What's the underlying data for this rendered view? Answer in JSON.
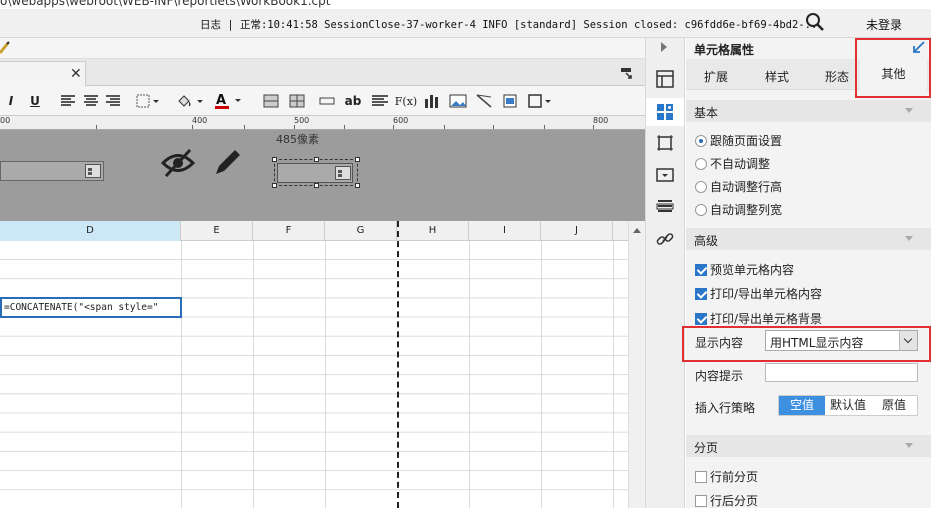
{
  "window": {
    "title_path": "o\\webapps\\webroot\\WEB-INF\\reportlets\\WorkBook1.cpt"
  },
  "statusbar": {
    "log_label": "日志",
    "log_text": "正常:10:41:58 SessionClose-37-worker-4 INFO [standard] Session closed: c96fdd6e-bf69-4bd2-...",
    "login_label": "未登录"
  },
  "design": {
    "width_label": "485像素"
  },
  "ruler": {
    "ticks": [
      "00",
      "400",
      "500",
      "600",
      "800"
    ]
  },
  "sheet": {
    "columns": [
      "D",
      "E",
      "F",
      "G",
      "H",
      "I",
      "J"
    ],
    "active_cell_text": "=CONCATENATE(\"<span style=\""
  },
  "toolbar": {
    "bold_label": "ab",
    "formula_label": "F(x)"
  },
  "panel": {
    "title": "单元格属性",
    "tabs": [
      "扩展",
      "样式",
      "形态",
      "其他"
    ],
    "active_tab": "其他",
    "basic": {
      "label": "基本",
      "options": [
        "跟随页面设置",
        "不自动调整",
        "自动调整行高",
        "自动调整列宽"
      ],
      "selected": "跟随页面设置"
    },
    "advanced": {
      "label": "高级",
      "checks": [
        "预览单元格内容",
        "打印/导出单元格内容",
        "打印/导出单元格背景"
      ],
      "display_label": "显示内容",
      "display_value": "用HTML显示内容",
      "hint_label": "内容提示",
      "hint_value": "",
      "insert_label": "插入行策略",
      "insert_options": [
        "空值",
        "默认值",
        "原值"
      ],
      "insert_selected": "空值"
    },
    "paging": {
      "label": "分页",
      "checks": [
        "行前分页",
        "行后分页"
      ]
    }
  },
  "colors": {
    "accent": "#2a77c9",
    "highlight_red": "#e03030",
    "selected_cell": "#2a6db6"
  }
}
